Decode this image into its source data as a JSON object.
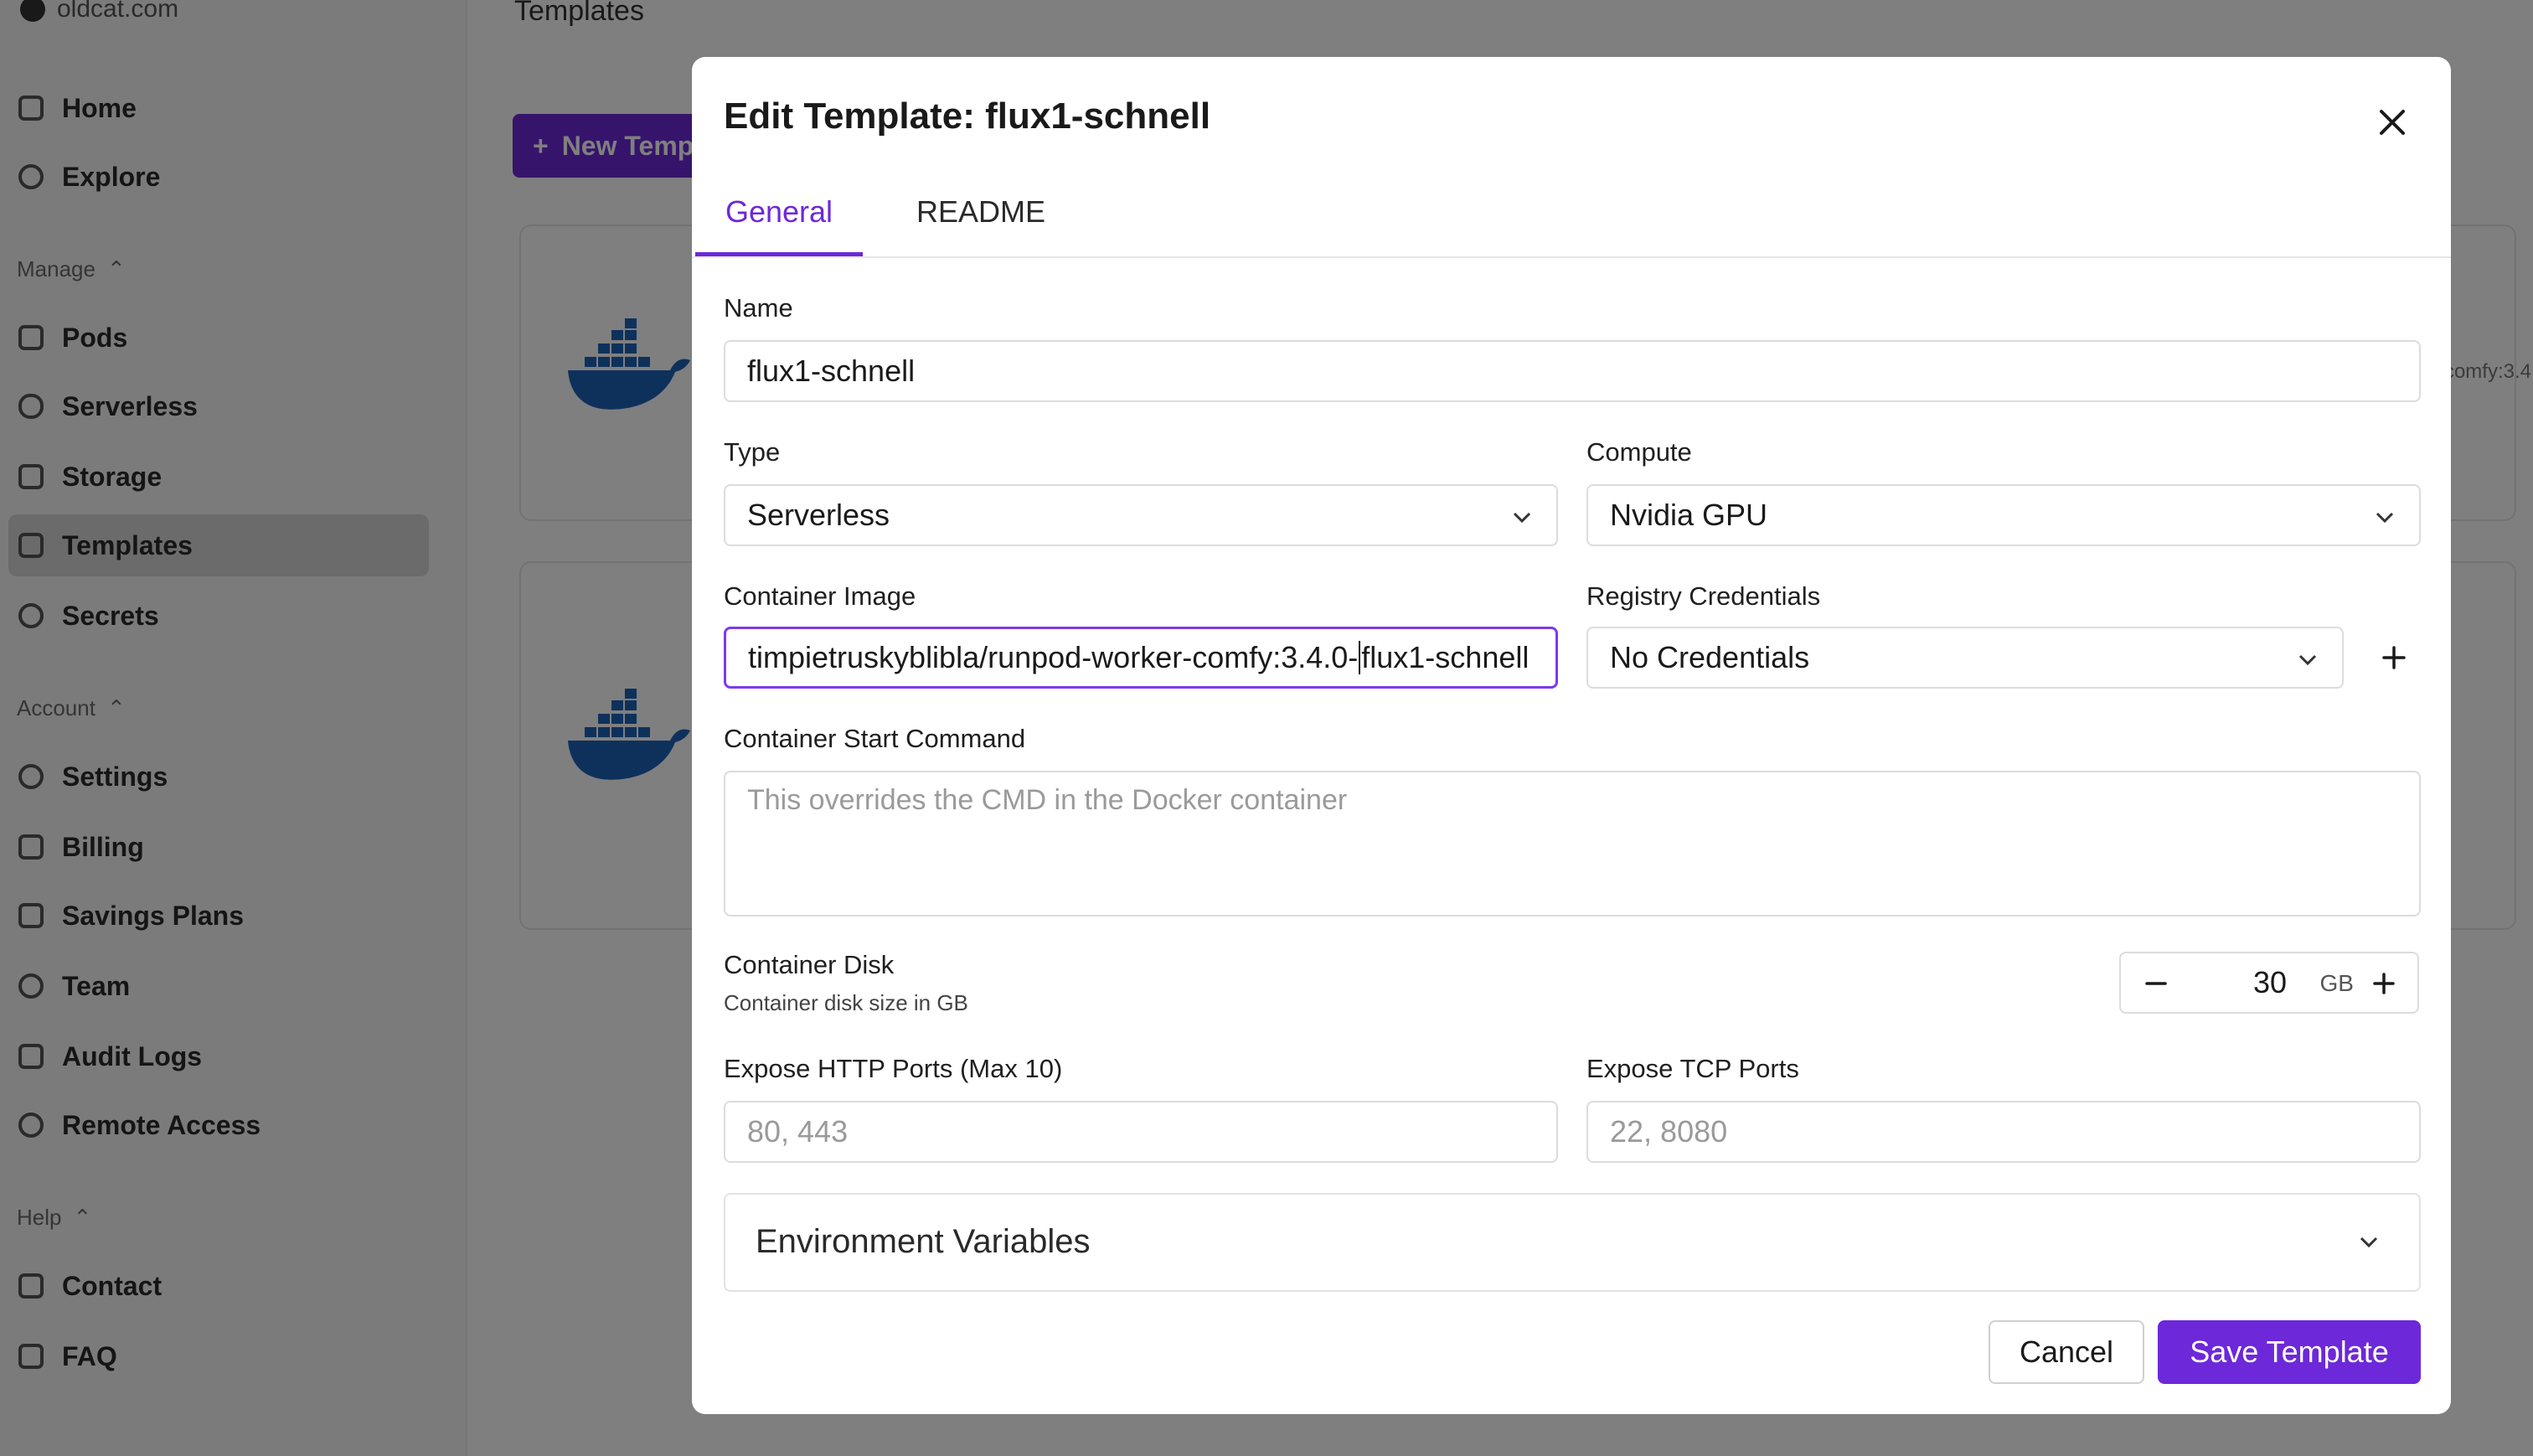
{
  "background": {
    "brand": "oldcat.com",
    "page_title": "Templates",
    "new_button_label": "New Template",
    "card_note": "comfy:3.4",
    "nav": {
      "home": "Home",
      "explore": "Explore",
      "manage_group": "Manage",
      "pods": "Pods",
      "serverless": "Serverless",
      "storage": "Storage",
      "templates": "Templates",
      "secrets": "Secrets",
      "account_group": "Account",
      "settings": "Settings",
      "billing": "Billing",
      "savings_plans": "Savings Plans",
      "team": "Team",
      "audit_logs": "Audit Logs",
      "remote_access": "Remote Access",
      "help_group": "Help",
      "contact": "Contact",
      "faq": "FAQ"
    }
  },
  "modal": {
    "title": "Edit Template: flux1-schnell",
    "tabs": {
      "general": "General",
      "readme": "README"
    },
    "name": {
      "label": "Name",
      "value": "flux1-schnell"
    },
    "type": {
      "label": "Type",
      "value": "Serverless"
    },
    "compute": {
      "label": "Compute",
      "value": "Nvidia GPU"
    },
    "container_image": {
      "label": "Container Image",
      "value_before_caret": "timpietruskyblibla/runpod-worker-comfy:3.4.0-",
      "value_after_caret": "flux1-schnell"
    },
    "registry": {
      "label": "Registry Credentials",
      "value": "No Credentials"
    },
    "start_command": {
      "label": "Container Start Command",
      "placeholder": "This overrides the CMD in the Docker container"
    },
    "disk": {
      "label": "Container Disk",
      "sublabel": "Container disk size in GB",
      "value": "30",
      "unit": "GB"
    },
    "http_ports": {
      "label": "Expose HTTP Ports (Max 10)",
      "placeholder": "80, 443"
    },
    "tcp_ports": {
      "label": "Expose TCP Ports",
      "placeholder": "22, 8080"
    },
    "env": {
      "label": "Environment Variables"
    },
    "buttons": {
      "cancel": "Cancel",
      "save": "Save Template"
    }
  },
  "colors": {
    "accent": "#6d28d9",
    "focus_border": "#7c3aed",
    "docker_blue": "#1d63b8"
  },
  "icons": [
    "close-icon",
    "chevron-down-icon",
    "plus-icon",
    "minus-icon",
    "docker-whale-icon"
  ]
}
